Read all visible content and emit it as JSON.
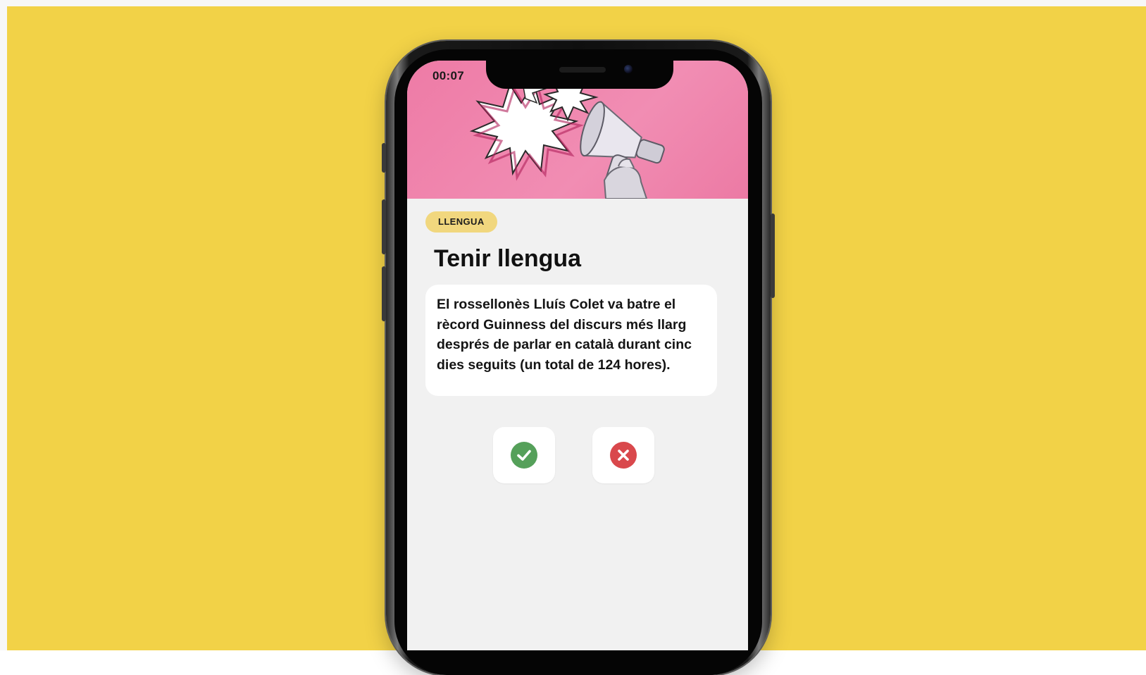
{
  "status_bar": {
    "time": "00:07"
  },
  "card": {
    "category": "LLENGUA",
    "title": "Tenir llengua",
    "fact": "El rossellonès Lluís Colet va batre el rècord Guinness del discurs més llarg després de parlar en català durant cinc dies seguits (un total de 124 hores)."
  },
  "answers": {
    "true_icon": "check-circle-icon",
    "false_icon": "x-circle-icon",
    "true_color": "#55a05a",
    "false_color": "#d9484c"
  },
  "colors": {
    "background": "#f2d247",
    "hero": "#f08bb1",
    "tag": "#f1d77e",
    "screen": "#f1f1f1"
  }
}
